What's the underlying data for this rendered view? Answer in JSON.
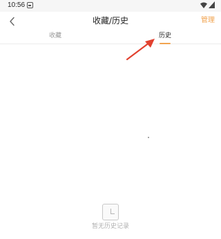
{
  "status_bar": {
    "time": "10:56",
    "icons": [
      "notification-icon",
      "wifi-icon",
      "signal-icon"
    ]
  },
  "header": {
    "back_icon": "chevron-left-icon",
    "title": "收藏/历史",
    "manage_label": "管理"
  },
  "tabs": [
    {
      "label": "收藏",
      "active": false
    },
    {
      "label": "历史",
      "active": true
    }
  ],
  "empty_state": {
    "icon": "empty-record-icon",
    "text": "暂无历史记录"
  },
  "colors": {
    "accent": "#f1a34f",
    "annotation_arrow": "#e2412f",
    "title_text": "#222222",
    "inactive_tab": "#9a9a9a",
    "empty_text": "#b0b0b0"
  }
}
